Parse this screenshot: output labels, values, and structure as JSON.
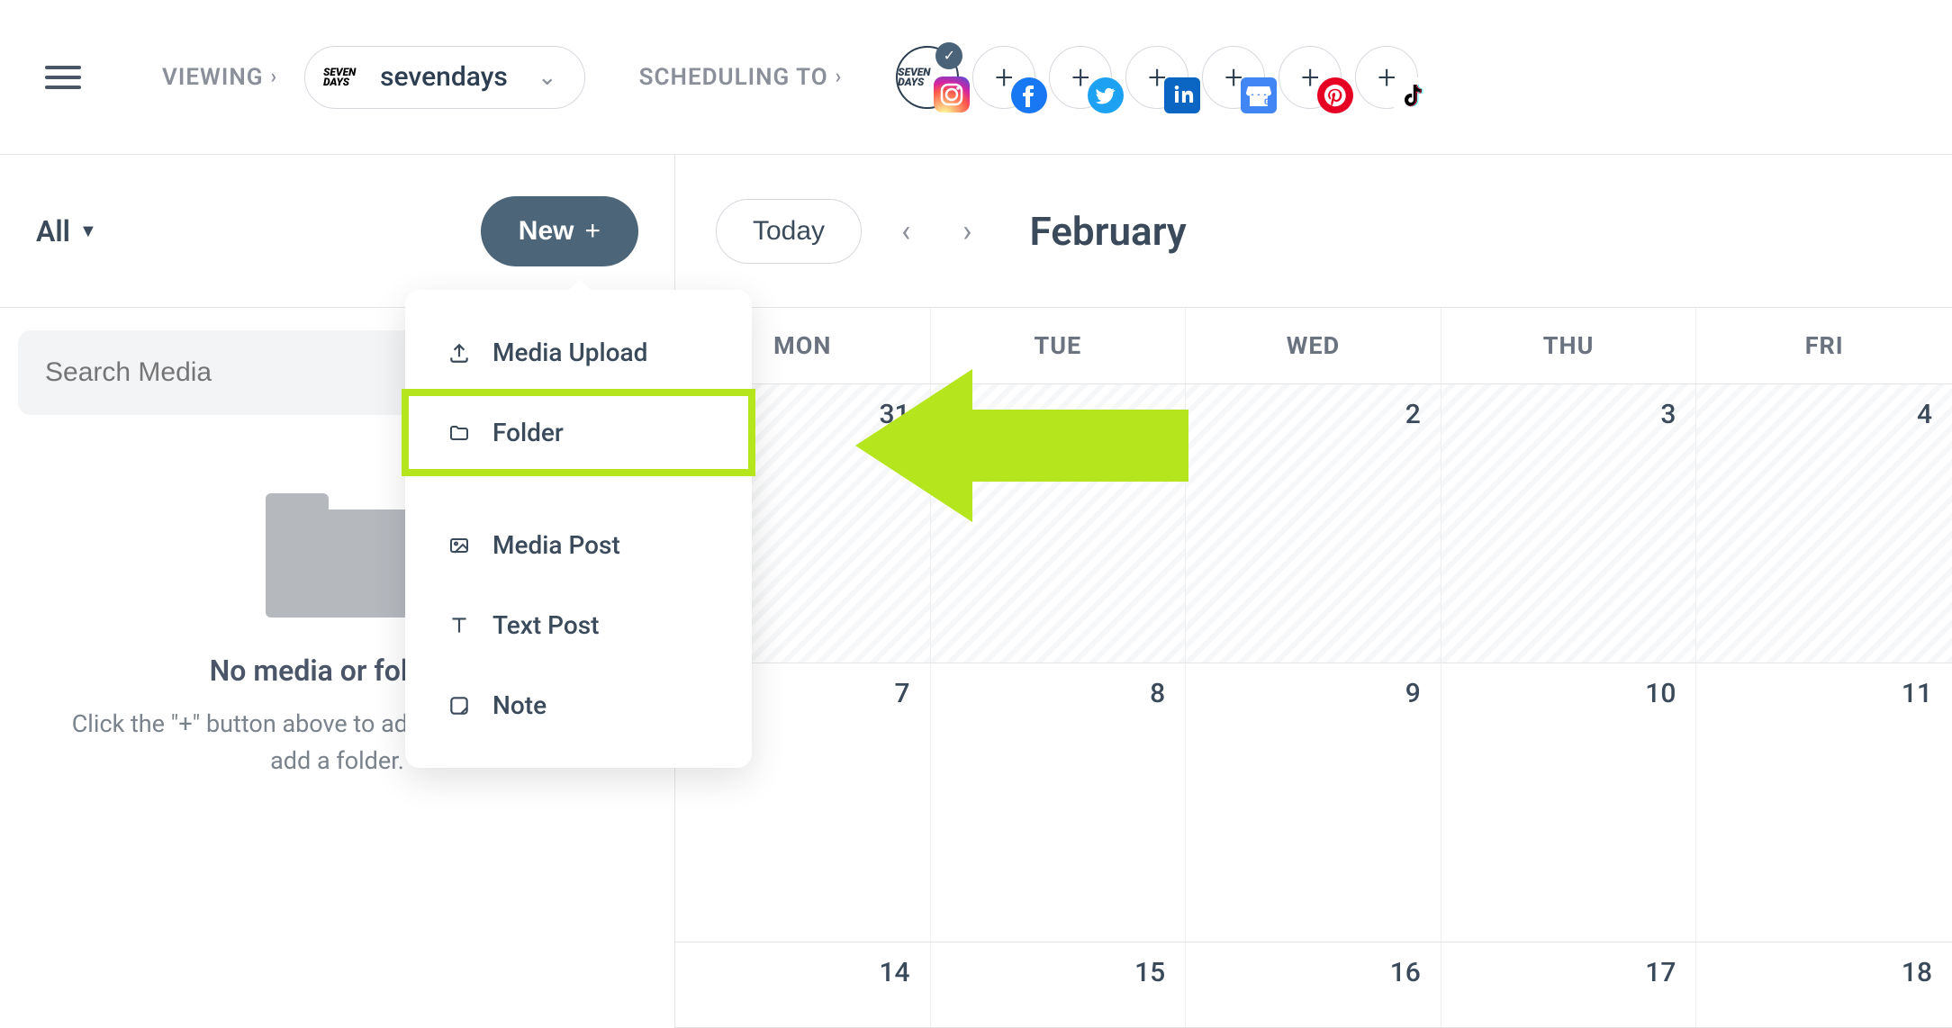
{
  "header": {
    "viewing_label": "VIEWING",
    "account_name": "sevendays",
    "account_logo_text": "SEVEN\nDAYS",
    "scheduling_label": "SCHEDULING TO",
    "social": [
      {
        "name": "instagram",
        "active": true,
        "check": true
      },
      {
        "name": "facebook"
      },
      {
        "name": "twitter"
      },
      {
        "name": "linkedin"
      },
      {
        "name": "google-my-business"
      },
      {
        "name": "pinterest"
      },
      {
        "name": "tiktok"
      }
    ]
  },
  "sidebar": {
    "filter_label": "All",
    "new_label": "New",
    "search_placeholder": "Search Media",
    "empty_title": "No media or folders",
    "empty_sub": "Click the \"+\" button above to add upload media or add a folder."
  },
  "dropdown": {
    "items": [
      {
        "icon": "upload",
        "label": "Media Upload"
      },
      {
        "icon": "folder",
        "label": "Folder",
        "highlighted": true
      },
      {
        "icon": "image",
        "label": "Media Post"
      },
      {
        "icon": "text",
        "label": "Text Post"
      },
      {
        "icon": "note",
        "label": "Note"
      }
    ]
  },
  "calendar": {
    "today_label": "Today",
    "month": "February",
    "day_names": [
      "MON",
      "TUE",
      "WED",
      "THU",
      "FRI"
    ],
    "weeks": [
      [
        {
          "n": "31",
          "hatched": true
        },
        {
          "n": "",
          "hatched": true
        },
        {
          "n": "2",
          "hatched": true
        },
        {
          "n": "3",
          "hatched": true
        },
        {
          "n": "4",
          "hatched": true
        }
      ],
      [
        {
          "n": "7"
        },
        {
          "n": "8"
        },
        {
          "n": "9"
        },
        {
          "n": "10"
        },
        {
          "n": "11"
        }
      ],
      [
        {
          "n": "14"
        },
        {
          "n": "15"
        },
        {
          "n": "16"
        },
        {
          "n": "17"
        },
        {
          "n": "18"
        }
      ]
    ]
  },
  "annotation": {
    "arrow_color": "#b5e61d"
  }
}
